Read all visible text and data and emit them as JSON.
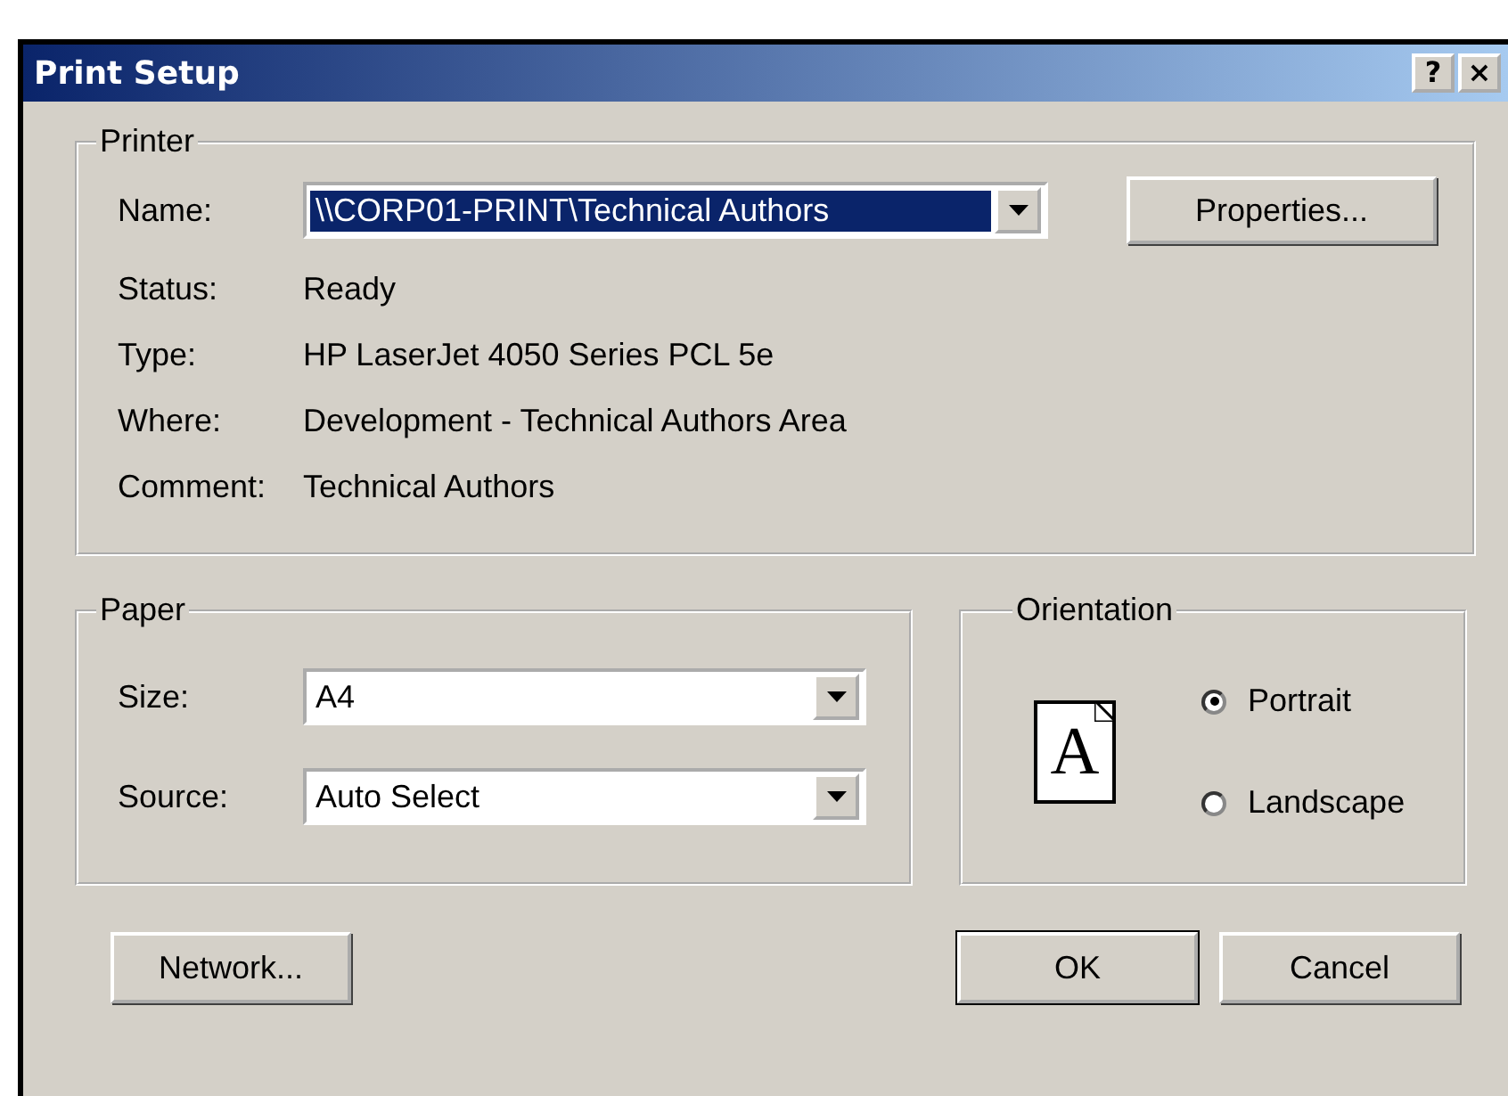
{
  "window": {
    "title": "Print Setup",
    "title_buttons": [
      "?",
      "×"
    ]
  },
  "printer": {
    "title": "Printer",
    "name": {
      "label": "Name:",
      "value": "\\\\CORP01-PRINT\\Technical Authors",
      "highlighted": true
    },
    "properties_button": "Properties...",
    "details": [
      {
        "label": "Status:",
        "value": "Ready"
      },
      {
        "label": "Type:",
        "value": "HP LaserJet 4050 Series PCL 5e"
      },
      {
        "label": "Where:",
        "value": "Development - Technical Authors Area"
      },
      {
        "label": "Comment:",
        "value": "Technical Authors"
      }
    ]
  },
  "paper": {
    "title": "Paper",
    "fields": [
      {
        "label": "Size:",
        "value": "A4"
      },
      {
        "label": "Source:",
        "value": "Auto Select"
      }
    ]
  },
  "orientation": {
    "title": "Orientation",
    "preview_letter": "A",
    "options": [
      {
        "label": "Portrait",
        "selected": true
      },
      {
        "label": "Landscape",
        "selected": false
      }
    ]
  },
  "buttons": [
    {
      "label": "Network...",
      "default": false
    },
    {
      "label": "OK",
      "default": true
    },
    {
      "label": "Cancel",
      "default": false
    }
  ]
}
